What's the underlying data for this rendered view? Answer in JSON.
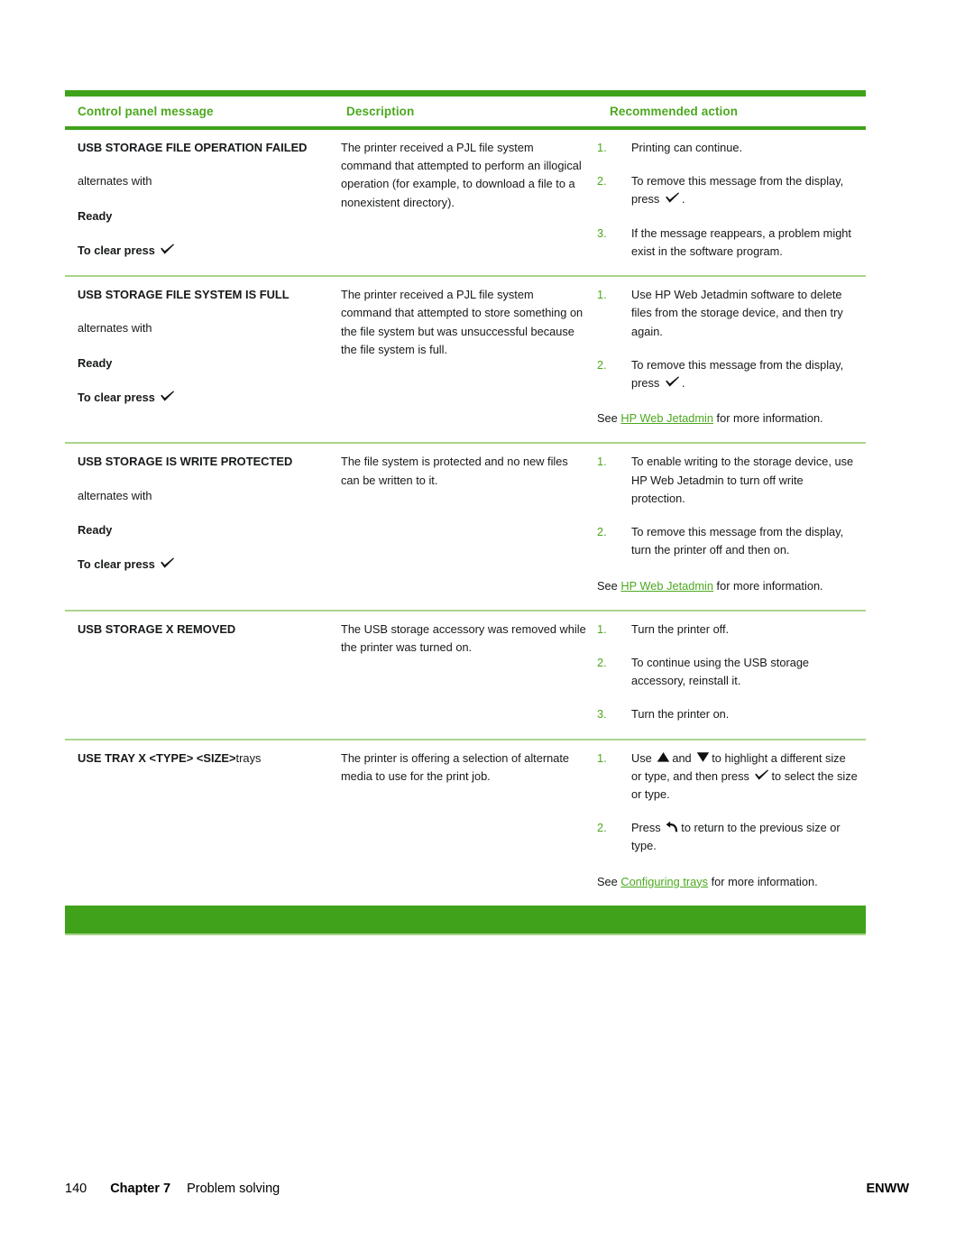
{
  "document": {
    "page_number": "140",
    "chapter": "Chapter 7",
    "section": "Problem solving",
    "edition_code": "ENWW"
  },
  "colors": {
    "header_green": "#4ca81f",
    "rule_green": "#3fa21a",
    "divider_green": "#a9d48b",
    "link_green": "#4ca81f"
  },
  "table": {
    "headers": {
      "col1": "Control panel message",
      "col2": "Description",
      "col3": "Recommended action"
    },
    "rows": [
      {
        "message": "USB STORAGE FILE OPERATION FAILED",
        "message_suffix": "",
        "alternates_label": "alternates with",
        "ready_label": "Ready",
        "to_clear_label": "To clear press",
        "description": "The printer received a PJL file system command that attempted to perform an illogical operation (for example, to download a file to a nonexistent directory).",
        "actions": [
          {
            "num": "1.",
            "text": "Printing can continue."
          },
          {
            "num": "2.",
            "text_before": "To remove this message from the display, press",
            "text_after": "."
          },
          {
            "num": "3.",
            "text": "If the message reappears, a problem might exist in the software program."
          }
        ],
        "see_line": null
      },
      {
        "message": "USB STORAGE FILE SYSTEM IS FULL",
        "message_suffix": "",
        "alternates_label": "alternates with",
        "ready_label": "Ready",
        "to_clear_label": "To clear press",
        "description": "The printer received a PJL file system command that attempted to store something on the file system but was unsuccessful because the file system is full.",
        "actions": [
          {
            "num": "1.",
            "text": "Use HP Web Jetadmin software to delete files from the storage device, and then try again."
          },
          {
            "num": "2.",
            "text_before": "To remove this message from the display, press",
            "text_after": "."
          }
        ],
        "see_line": {
          "prefix": "See ",
          "link": "HP Web Jetadmin",
          "suffix": " for more information."
        }
      },
      {
        "message": "USB STORAGE IS WRITE PROTECTED",
        "message_suffix": "",
        "alternates_label": "alternates with",
        "ready_label": "Ready",
        "to_clear_label": "To clear press",
        "description": "The file system is protected and no new files can be written to it.",
        "actions": [
          {
            "num": "1.",
            "text": "To enable writing to the storage device, use HP Web Jetadmin to turn off write protection."
          },
          {
            "num": "2.",
            "text": "To remove this message from the display, turn the printer off and then on."
          }
        ],
        "see_line": {
          "prefix": "See ",
          "link": "HP Web Jetadmin",
          "suffix": " for more information."
        }
      },
      {
        "message": "USB STORAGE X REMOVED",
        "message_suffix": "",
        "alternates_label": null,
        "ready_label": null,
        "to_clear_label": null,
        "description": "The USB storage accessory was removed while the printer was turned on.",
        "actions": [
          {
            "num": "1.",
            "text": "Turn the printer off."
          },
          {
            "num": "2.",
            "text": "To continue using the USB storage accessory, reinstall it."
          },
          {
            "num": "3.",
            "text": "Turn the printer on."
          }
        ],
        "see_line": null
      },
      {
        "message": "USE TRAY X <TYPE> <SIZE>",
        "message_suffix": "trays",
        "alternates_label": null,
        "ready_label": null,
        "to_clear_label": null,
        "description": "The printer is offering a selection of alternate media to use for the print job.",
        "actions": [
          {
            "num": "1.",
            "text_use": "Use",
            "text_and": "and",
            "text_after_arrows": "to highlight a different size or type, and then press",
            "text_tail": "to select the size or type."
          },
          {
            "num": "2.",
            "text_press": "Press",
            "text_after_ret": "to return to the previous size or type."
          }
        ],
        "see_line": {
          "prefix": "See ",
          "link": "Configuring trays",
          "suffix": " for more information."
        }
      }
    ]
  },
  "icons": {
    "check": "check-icon",
    "up_arrow": "up-arrow-icon",
    "down_arrow": "down-arrow-icon",
    "return_arrow": "return-arrow-icon"
  }
}
